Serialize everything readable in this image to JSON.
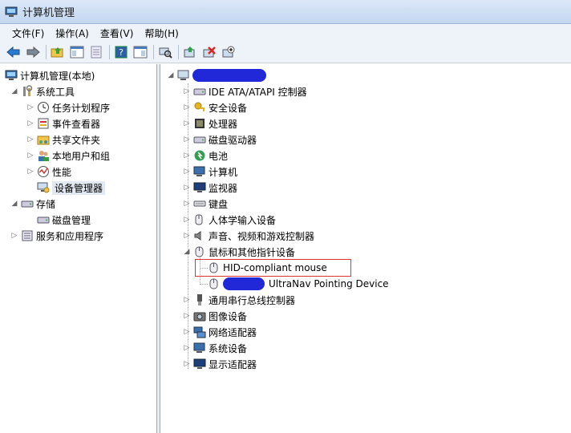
{
  "window": {
    "title": "计算机管理"
  },
  "menu": [
    {
      "label": "文件(F)"
    },
    {
      "label": "操作(A)"
    },
    {
      "label": "查看(V)"
    },
    {
      "label": "帮助(H)"
    }
  ],
  "toolbar": {
    "buttons": [
      "back-icon",
      "forward-icon",
      "up-folder-icon",
      "console-tree-icon",
      "properties-icon",
      "help-icon",
      "action-pane-icon",
      "scan-hardware-icon",
      "update-driver-icon",
      "uninstall-icon",
      "disable-icon"
    ]
  },
  "left_tree": {
    "root": "计算机管理(本地)",
    "system_tools": "系统工具",
    "task_scheduler": "任务计划程序",
    "event_viewer": "事件查看器",
    "shared_folders": "共享文件夹",
    "local_users": "本地用户和组",
    "performance": "性能",
    "device_manager": "设备管理器",
    "storage": "存储",
    "disk_management": "磁盘管理",
    "services_apps": "服务和应用程序"
  },
  "devices": {
    "ide": "IDE ATA/ATAPI 控制器",
    "security": "安全设备",
    "processor": "处理器",
    "disk": "磁盘驱动器",
    "battery": "电池",
    "computer": "计算机",
    "monitor": "监视器",
    "keyboard": "键盘",
    "hid": "人体学输入设备",
    "sound": "声音、视频和游戏控制器",
    "mouse": "鼠标和其他指针设备",
    "mouse_child_1": "HID-compliant mouse",
    "mouse_child_2": "UltraNav Pointing Device",
    "usb": "通用串行总线控制器",
    "imaging": "图像设备",
    "network": "网络适配器",
    "system": "系统设备",
    "display": "显示适配器"
  }
}
